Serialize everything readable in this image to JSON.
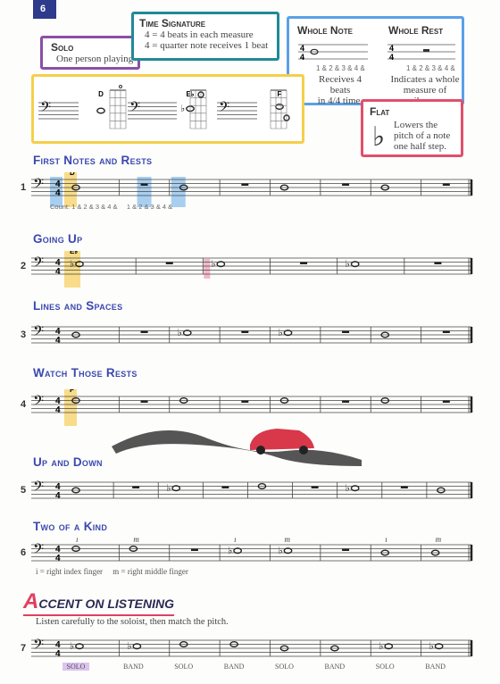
{
  "page_number": "6",
  "solo_box": {
    "title": "Solo",
    "text": "One person playing"
  },
  "time_signature_box": {
    "title": "Time Signature",
    "line1": "4 = 4 beats in each measure",
    "line2": "4 = quarter note receives 1 beat"
  },
  "whole_note_box": {
    "title": "Whole Note",
    "count": "1 & 2 & 3 & 4 &",
    "text1": "Receives 4 beats",
    "text2": "in 4/4 time."
  },
  "whole_rest_box": {
    "title": "Whole Rest",
    "count": "1 & 2 & 3 & 4 &",
    "text1": "Indicates a whole",
    "text2": "measure of silence."
  },
  "flat_box": {
    "title": "Flat",
    "text1": "Lowers the",
    "text2": "pitch of a note",
    "text3": "one half step."
  },
  "notes_box": [
    {
      "name": "D"
    },
    {
      "name": "E♭"
    },
    {
      "name": "F"
    }
  ],
  "sections": [
    {
      "title": "First Notes and Rests",
      "number": "1",
      "note_label": "D",
      "count_label": "Count: 1 & 2 & 3 & 4 &     1 & 2 & 3 & 4 &",
      "measures": [
        "D",
        "R",
        "D",
        "R",
        "D",
        "R",
        "D",
        "R"
      ]
    },
    {
      "title": "Going Up",
      "number": "2",
      "note_label": "E♭",
      "measures": [
        "Eb",
        "R",
        "Eb",
        "R",
        "Eb",
        "R"
      ]
    },
    {
      "title": "Lines and Spaces",
      "number": "3",
      "measures": [
        "D",
        "R",
        "Eb",
        "R",
        "Eb",
        "R",
        "D",
        "R"
      ]
    },
    {
      "title": "Watch Those Rests",
      "number": "4",
      "note_label": "F",
      "measures": [
        "F",
        "R",
        "F",
        "R",
        "F",
        "R",
        "F",
        "R"
      ]
    },
    {
      "title": "Up and Down",
      "number": "5",
      "measures": [
        "D",
        "R",
        "Eb",
        "R",
        "F",
        "R",
        "Eb",
        "R",
        "D"
      ]
    },
    {
      "title": "Two of a Kind",
      "number": "6",
      "measures": [
        "F",
        "F",
        "R",
        "Eb",
        "Eb",
        "R",
        "D",
        "D"
      ],
      "fingering": [
        "i",
        "m",
        "",
        "i",
        "m",
        "",
        "i",
        "m"
      ],
      "legend": "i = right index finger     m = right middle finger"
    },
    {
      "title": "",
      "number": "7",
      "measures": [
        "Eb",
        "Eb",
        "F",
        "F",
        "D",
        "D",
        "Eb",
        "Eb"
      ],
      "labels": [
        "SOLO",
        "BAND",
        "SOLO",
        "BAND",
        "SOLO",
        "BAND",
        "SOLO",
        "BAND"
      ]
    }
  ],
  "accent": {
    "first_letter": "A",
    "rest": "CCENT ON LISTENING",
    "instruction": "Listen carefully to the soloist, then match the pitch."
  },
  "colors": {
    "heading": "#3a48b0",
    "highlight_blue": "#a8cff0",
    "highlight_yellow": "#f8dc8a",
    "highlight_pink": "#f4b8c8",
    "solo_highlight": "#dcc4f0"
  }
}
